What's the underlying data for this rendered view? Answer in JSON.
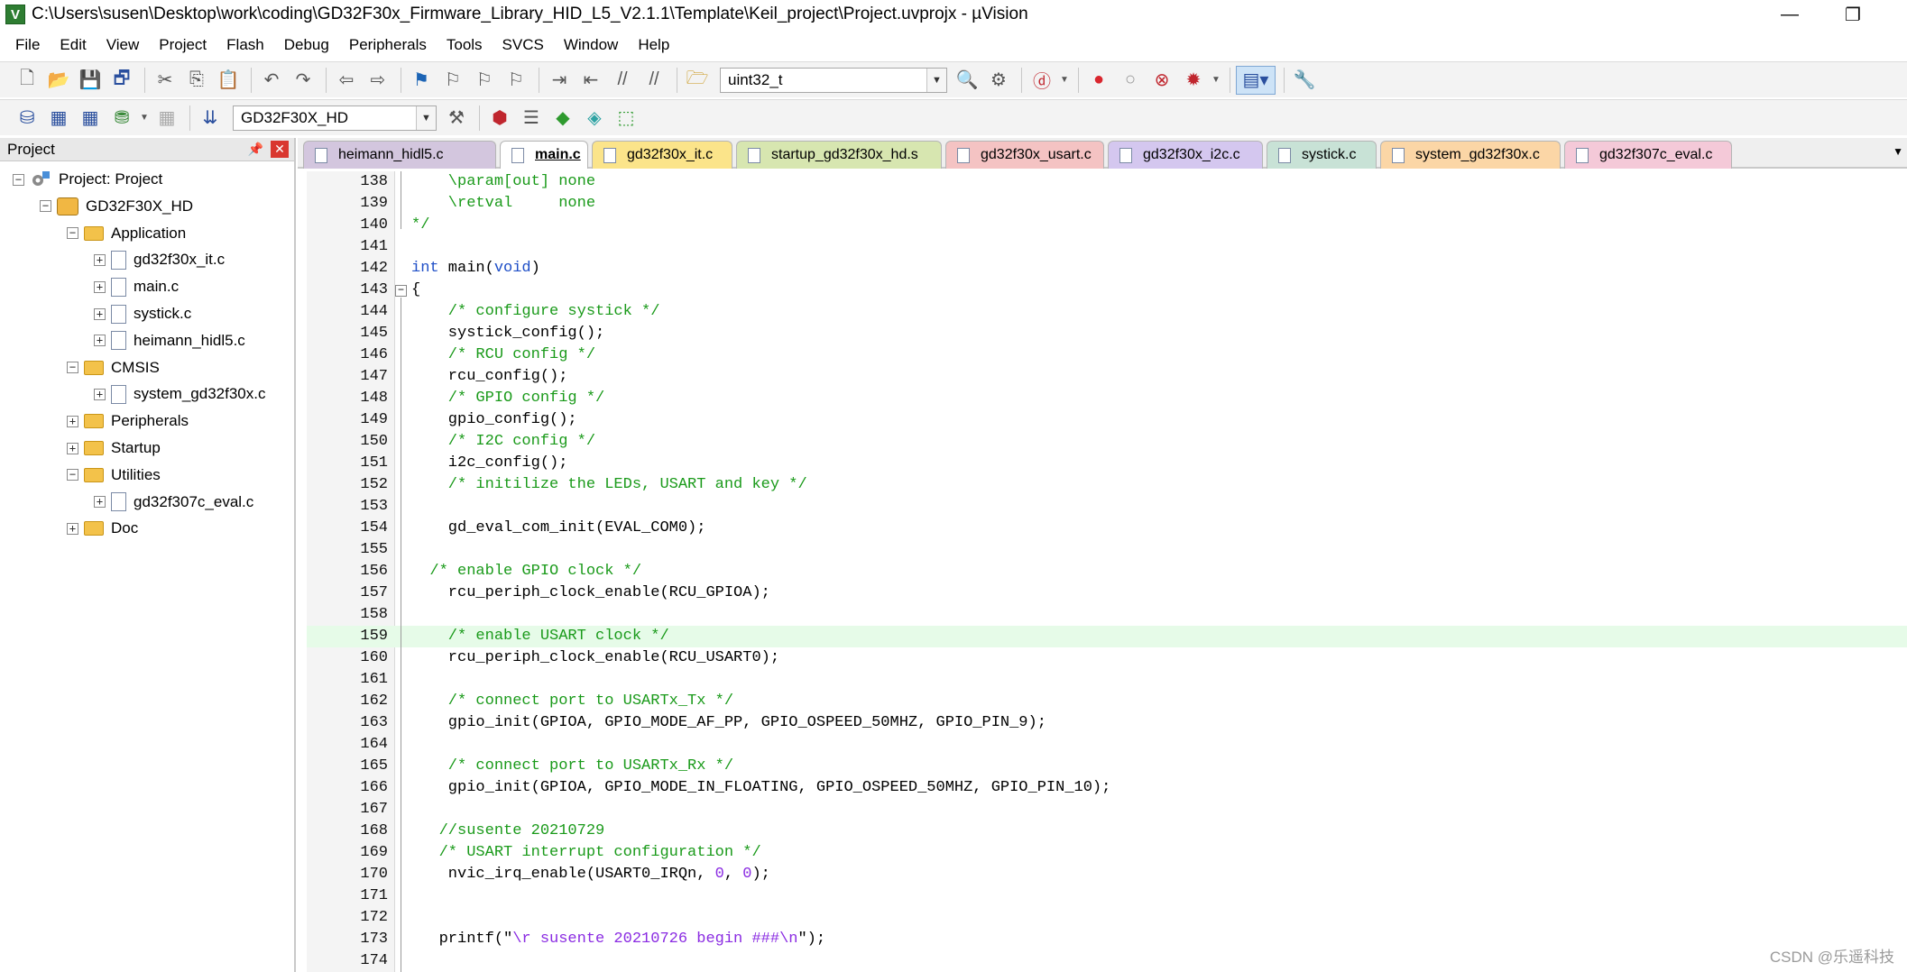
{
  "window": {
    "title": "C:\\Users\\susen\\Desktop\\work\\coding\\GD32F30x_Firmware_Library_HID_L5_V2.1.1\\Template\\Keil_project\\Project.uvprojx - µVision",
    "icon_glyph": "V",
    "minimize_glyph": "—",
    "restore_glyph": "❐"
  },
  "menu": [
    "File",
    "Edit",
    "View",
    "Project",
    "Flash",
    "Debug",
    "Peripherals",
    "Tools",
    "SVCS",
    "Window",
    "Help"
  ],
  "toolbar": {
    "find_combo": "uint32_t",
    "target_combo": "GD32F30X_HD"
  },
  "project_panel": {
    "title": "Project",
    "pin_glyph": "📌",
    "close_glyph": "✕",
    "tree": [
      {
        "label": "Project: Project",
        "level": 0,
        "kind": "project",
        "exp": "−"
      },
      {
        "label": "GD32F30X_HD",
        "level": 1,
        "kind": "target",
        "exp": "−"
      },
      {
        "label": "Application",
        "level": 2,
        "kind": "folder-open",
        "exp": "−"
      },
      {
        "label": "gd32f30x_it.c",
        "level": 3,
        "kind": "file",
        "exp": "+"
      },
      {
        "label": "main.c",
        "level": 3,
        "kind": "file",
        "exp": "+"
      },
      {
        "label": "systick.c",
        "level": 3,
        "kind": "file",
        "exp": "+"
      },
      {
        "label": "heimann_hidl5.c",
        "level": 3,
        "kind": "file",
        "exp": "+"
      },
      {
        "label": "CMSIS",
        "level": 2,
        "kind": "folder-open",
        "exp": "−"
      },
      {
        "label": "system_gd32f30x.c",
        "level": 3,
        "kind": "file",
        "exp": "+"
      },
      {
        "label": "Peripherals",
        "level": 2,
        "kind": "folder",
        "exp": "+"
      },
      {
        "label": "Startup",
        "level": 2,
        "kind": "folder",
        "exp": "+"
      },
      {
        "label": "Utilities",
        "level": 2,
        "kind": "folder-open",
        "exp": "−"
      },
      {
        "label": "gd32f307c_eval.c",
        "level": 3,
        "kind": "file",
        "exp": "+"
      },
      {
        "label": "Doc",
        "level": 2,
        "kind": "folder",
        "exp": "+"
      }
    ]
  },
  "tabs": [
    {
      "label": "heimann_hidl5.c",
      "color": "#d3c6de",
      "active": false
    },
    {
      "label": "main.c",
      "color": "#ffffff",
      "active": true
    },
    {
      "label": "gd32f30x_it.c",
      "color": "#fbe48a",
      "active": false
    },
    {
      "label": "startup_gd32f30x_hd.s",
      "color": "#d7e6b0",
      "active": false
    },
    {
      "label": "gd32f30x_usart.c",
      "color": "#f4c3c3",
      "active": false
    },
    {
      "label": "gd32f30x_i2c.c",
      "color": "#d4c7ef",
      "active": false
    },
    {
      "label": "systick.c",
      "color": "#c8e2d6",
      "active": false
    },
    {
      "label": "system_gd32f30x.c",
      "color": "#fbd6a6",
      "active": false
    },
    {
      "label": "gd32f307c_eval.c",
      "color": "#f4c9d8",
      "active": false
    }
  ],
  "tab_menu_glyph": "▼",
  "colors": {
    "comment": "#1a9a1a",
    "keyword": "#1f4fc7",
    "number": "#8a2be2",
    "highlight_line": "#e6fbe8"
  },
  "code": [
    {
      "n": "138",
      "segs": [
        [
          "c",
          "    \\param[out] none"
        ]
      ]
    },
    {
      "n": "139",
      "segs": [
        [
          "c",
          "    \\retval     none"
        ]
      ]
    },
    {
      "n": "140",
      "segs": [
        [
          "c",
          "*/"
        ]
      ]
    },
    {
      "n": "141",
      "segs": []
    },
    {
      "n": "142",
      "segs": [
        [
          "k",
          "int"
        ],
        [
          "t",
          " main("
        ],
        [
          "k",
          "void"
        ],
        [
          "t",
          ")"
        ]
      ]
    },
    {
      "n": "143",
      "segs": [
        [
          "t",
          "{"
        ]
      ],
      "fold": true
    },
    {
      "n": "144",
      "segs": [
        [
          "c",
          "    /* configure systick */"
        ]
      ]
    },
    {
      "n": "145",
      "segs": [
        [
          "t",
          "    systick_config();"
        ]
      ]
    },
    {
      "n": "146",
      "segs": [
        [
          "c",
          "    /* RCU config */"
        ]
      ]
    },
    {
      "n": "147",
      "segs": [
        [
          "t",
          "    rcu_config();"
        ]
      ]
    },
    {
      "n": "148",
      "segs": [
        [
          "c",
          "    /* GPIO config */"
        ]
      ]
    },
    {
      "n": "149",
      "segs": [
        [
          "t",
          "    gpio_config();"
        ]
      ]
    },
    {
      "n": "150",
      "segs": [
        [
          "c",
          "    /* I2C config */"
        ]
      ]
    },
    {
      "n": "151",
      "segs": [
        [
          "t",
          "    i2c_config();"
        ]
      ]
    },
    {
      "n": "152",
      "segs": [
        [
          "c",
          "    /* initilize the LEDs, USART and key */"
        ]
      ]
    },
    {
      "n": "153",
      "segs": []
    },
    {
      "n": "154",
      "segs": [
        [
          "t",
          "    gd_eval_com_init(EVAL_COM0);"
        ]
      ]
    },
    {
      "n": "155",
      "segs": []
    },
    {
      "n": "156",
      "segs": [
        [
          "c",
          "  /* enable GPIO clock */"
        ]
      ]
    },
    {
      "n": "157",
      "segs": [
        [
          "t",
          "    rcu_periph_clock_enable(RCU_GPIOA);"
        ]
      ]
    },
    {
      "n": "158",
      "segs": []
    },
    {
      "n": "159",
      "segs": [
        [
          "c",
          "    /* enable USART clock */"
        ]
      ],
      "hl": true
    },
    {
      "n": "160",
      "segs": [
        [
          "t",
          "    rcu_periph_clock_enable(RCU_USART0);"
        ]
      ]
    },
    {
      "n": "161",
      "segs": []
    },
    {
      "n": "162",
      "segs": [
        [
          "c",
          "    /* connect port to USARTx_Tx */"
        ]
      ]
    },
    {
      "n": "163",
      "segs": [
        [
          "t",
          "    gpio_init(GPIOA, GPIO_MODE_AF_PP, GPIO_OSPEED_50MHZ, GPIO_PIN_9);"
        ]
      ]
    },
    {
      "n": "164",
      "segs": []
    },
    {
      "n": "165",
      "segs": [
        [
          "c",
          "    /* connect port to USARTx_Rx */"
        ]
      ]
    },
    {
      "n": "166",
      "segs": [
        [
          "t",
          "    gpio_init(GPIOA, GPIO_MODE_IN_FLOATING, GPIO_OSPEED_50MHZ, GPIO_PIN_10);"
        ]
      ]
    },
    {
      "n": "167",
      "segs": []
    },
    {
      "n": "168",
      "segs": [
        [
          "c",
          "   //susente 20210729"
        ]
      ]
    },
    {
      "n": "169",
      "segs": [
        [
          "c",
          "   /* USART interrupt configuration */"
        ]
      ]
    },
    {
      "n": "170",
      "segs": [
        [
          "t",
          "    nvic_irq_enable(USART0_IRQn, "
        ],
        [
          "n",
          "0"
        ],
        [
          "t",
          ", "
        ],
        [
          "n",
          "0"
        ],
        [
          "t",
          ");"
        ]
      ]
    },
    {
      "n": "171",
      "segs": []
    },
    {
      "n": "172",
      "segs": []
    },
    {
      "n": "173",
      "segs": [
        [
          "t",
          "   printf(\""
        ],
        [
          "s",
          "\\r susente 20210726 begin ###\\n"
        ],
        [
          "t",
          "\");"
        ]
      ]
    },
    {
      "n": "174",
      "segs": []
    }
  ],
  "watermark": "CSDN @乐遥科技"
}
